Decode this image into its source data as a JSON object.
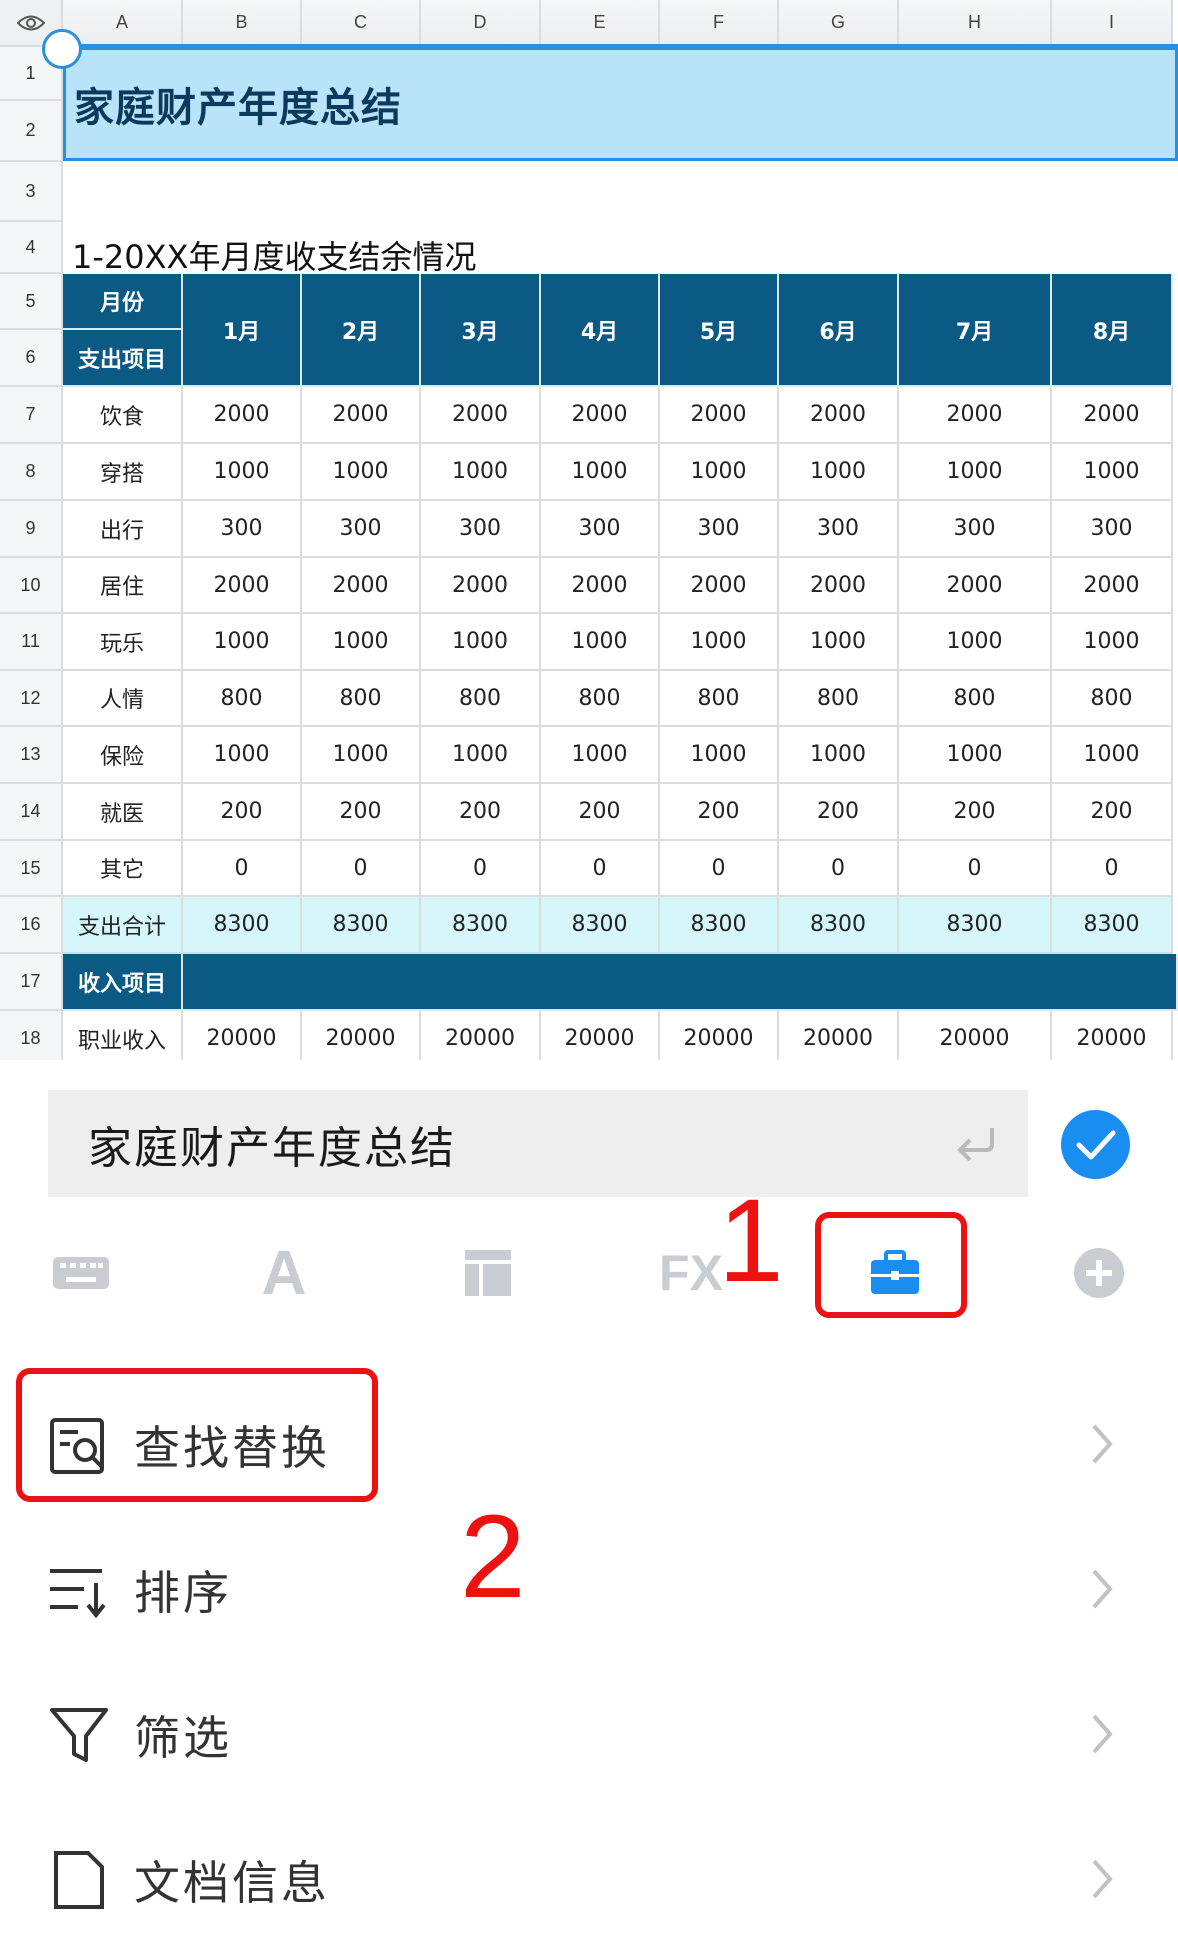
{
  "columns": [
    "A",
    "B",
    "C",
    "D",
    "E",
    "F",
    "G",
    "H",
    "I"
  ],
  "rows": [
    "1",
    "2",
    "3",
    "4",
    "5",
    "6",
    "7",
    "8",
    "9",
    "10",
    "11",
    "12",
    "13",
    "14",
    "15",
    "16",
    "17",
    "18"
  ],
  "sheet": {
    "title": "家庭财产年度总结",
    "subtitle": "1-20XX年月度收支结余情况",
    "header_month_label": "月份",
    "header_item_label": "支出项目",
    "months": [
      "1月",
      "2月",
      "3月",
      "4月",
      "5月",
      "6月",
      "7月",
      "8月"
    ],
    "expense_rows": [
      {
        "label": "饮食",
        "values": [
          "2000",
          "2000",
          "2000",
          "2000",
          "2000",
          "2000",
          "2000",
          "2000"
        ]
      },
      {
        "label": "穿搭",
        "values": [
          "1000",
          "1000",
          "1000",
          "1000",
          "1000",
          "1000",
          "1000",
          "1000"
        ]
      },
      {
        "label": "出行",
        "values": [
          "300",
          "300",
          "300",
          "300",
          "300",
          "300",
          "300",
          "300"
        ]
      },
      {
        "label": "居住",
        "values": [
          "2000",
          "2000",
          "2000",
          "2000",
          "2000",
          "2000",
          "2000",
          "2000"
        ]
      },
      {
        "label": "玩乐",
        "values": [
          "1000",
          "1000",
          "1000",
          "1000",
          "1000",
          "1000",
          "1000",
          "1000"
        ]
      },
      {
        "label": "人情",
        "values": [
          "800",
          "800",
          "800",
          "800",
          "800",
          "800",
          "800",
          "800"
        ]
      },
      {
        "label": "保险",
        "values": [
          "1000",
          "1000",
          "1000",
          "1000",
          "1000",
          "1000",
          "1000",
          "1000"
        ]
      },
      {
        "label": "就医",
        "values": [
          "200",
          "200",
          "200",
          "200",
          "200",
          "200",
          "200",
          "200"
        ]
      },
      {
        "label": "其它",
        "values": [
          "0",
          "0",
          "0",
          "0",
          "0",
          "0",
          "0",
          "0"
        ]
      }
    ],
    "total_row": {
      "label": "支出合计",
      "values": [
        "8300",
        "8300",
        "8300",
        "8300",
        "8300",
        "8300",
        "8300",
        "8300"
      ]
    },
    "income_header": "收入项目",
    "income_rows": [
      {
        "label": "职业收入",
        "values": [
          "20000",
          "20000",
          "20000",
          "20000",
          "20000",
          "20000",
          "20000",
          "20000"
        ]
      }
    ]
  },
  "formula_bar": {
    "text": "家庭财产年度总结"
  },
  "toolbar": {
    "items": [
      "keyboard-icon",
      "font-icon",
      "layout-icon",
      "fx-icon",
      "toolbox-icon",
      "add-icon"
    ],
    "fx_label": "FX",
    "font_label": "A"
  },
  "menu": {
    "items": [
      {
        "label": "查找替换",
        "icon": "find-replace-icon"
      },
      {
        "label": "排序",
        "icon": "sort-icon"
      },
      {
        "label": "筛选",
        "icon": "filter-icon"
      },
      {
        "label": "文档信息",
        "icon": "document-info-icon"
      }
    ]
  },
  "annotations": {
    "one": "1",
    "two": "2",
    "color": "#ee1111"
  },
  "colors": {
    "header_blue": "#0a5a85",
    "accent": "#1a8df0",
    "title_band": "#b8e3f8",
    "total_row": "#d5f6fb"
  }
}
